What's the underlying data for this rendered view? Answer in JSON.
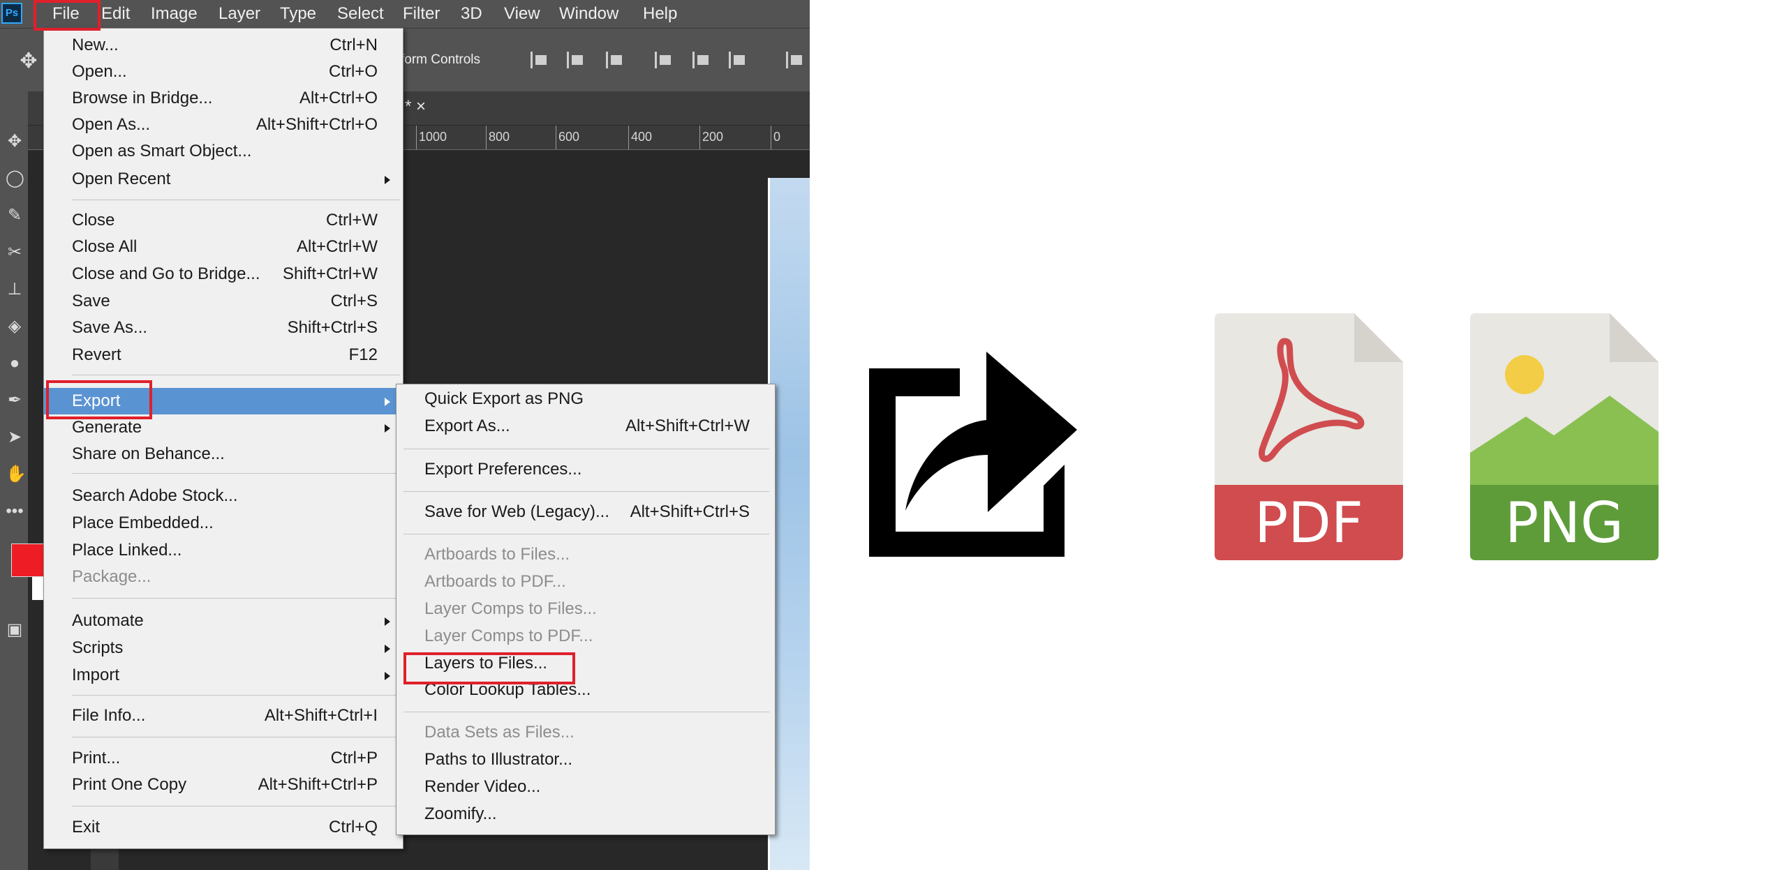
{
  "app": {
    "logo_text": "Ps"
  },
  "menubar": [
    {
      "label": "File"
    },
    {
      "label": "Edit"
    },
    {
      "label": "Image"
    },
    {
      "label": "Layer"
    },
    {
      "label": "Type"
    },
    {
      "label": "Select"
    },
    {
      "label": "Filter"
    },
    {
      "label": "3D"
    },
    {
      "label": "View"
    },
    {
      "label": "Window"
    },
    {
      "label": "Help"
    }
  ],
  "options_bar": {
    "transform_controls": "form Controls"
  },
  "document_tab": {
    "label": "* ×"
  },
  "ruler": {
    "labels": [
      "1000",
      "800",
      "600",
      "400",
      "200",
      "0"
    ]
  },
  "file_menu": {
    "items": [
      {
        "label": "New...",
        "shortcut": "Ctrl+N"
      },
      {
        "label": "Open...",
        "shortcut": "Ctrl+O"
      },
      {
        "label": "Browse in Bridge...",
        "shortcut": "Alt+Ctrl+O"
      },
      {
        "label": "Open As...",
        "shortcut": "Alt+Shift+Ctrl+O"
      },
      {
        "label": "Open as Smart Object...",
        "shortcut": ""
      },
      {
        "label": "Open Recent",
        "shortcut": "",
        "submenu": true
      },
      {
        "label": "Close",
        "shortcut": "Ctrl+W"
      },
      {
        "label": "Close All",
        "shortcut": "Alt+Ctrl+W"
      },
      {
        "label": "Close and Go to Bridge...",
        "shortcut": "Shift+Ctrl+W"
      },
      {
        "label": "Save",
        "shortcut": "Ctrl+S"
      },
      {
        "label": "Save As...",
        "shortcut": "Shift+Ctrl+S"
      },
      {
        "label": "Revert",
        "shortcut": "F12"
      },
      {
        "label": "Export",
        "shortcut": "",
        "submenu": true,
        "highlighted": true
      },
      {
        "label": "Generate",
        "shortcut": "",
        "submenu": true
      },
      {
        "label": "Share on Behance...",
        "shortcut": ""
      },
      {
        "label": "Search Adobe Stock...",
        "shortcut": ""
      },
      {
        "label": "Place Embedded...",
        "shortcut": ""
      },
      {
        "label": "Place Linked...",
        "shortcut": ""
      },
      {
        "label": "Package...",
        "shortcut": "",
        "disabled": true
      },
      {
        "label": "Automate",
        "shortcut": "",
        "submenu": true
      },
      {
        "label": "Scripts",
        "shortcut": "",
        "submenu": true
      },
      {
        "label": "Import",
        "shortcut": "",
        "submenu": true
      },
      {
        "label": "File Info...",
        "shortcut": "Alt+Shift+Ctrl+I"
      },
      {
        "label": "Print...",
        "shortcut": "Ctrl+P"
      },
      {
        "label": "Print One Copy",
        "shortcut": "Alt+Shift+Ctrl+P"
      },
      {
        "label": "Exit",
        "shortcut": "Ctrl+Q"
      }
    ]
  },
  "export_menu": {
    "items": [
      {
        "label": "Quick Export as PNG",
        "shortcut": ""
      },
      {
        "label": "Export As...",
        "shortcut": "Alt+Shift+Ctrl+W"
      },
      {
        "label": "Export Preferences...",
        "shortcut": ""
      },
      {
        "label": "Save for Web (Legacy)...",
        "shortcut": "Alt+Shift+Ctrl+S"
      },
      {
        "label": "Artboards to Files...",
        "shortcut": "",
        "disabled": true
      },
      {
        "label": "Artboards to PDF...",
        "shortcut": "",
        "disabled": true
      },
      {
        "label": "Layer Comps to Files...",
        "shortcut": "",
        "disabled": true
      },
      {
        "label": "Layer Comps to PDF...",
        "shortcut": "",
        "disabled": true
      },
      {
        "label": "Layers to Files...",
        "shortcut": ""
      },
      {
        "label": "Color Lookup Tables...",
        "shortcut": ""
      },
      {
        "label": "Data Sets as Files...",
        "shortcut": "",
        "disabled": true
      },
      {
        "label": "Paths to Illustrator...",
        "shortcut": ""
      },
      {
        "label": "Render Video...",
        "shortcut": ""
      },
      {
        "label": "Zoomify...",
        "shortcut": ""
      }
    ]
  },
  "illustration": {
    "export_icon": "share-export-icon",
    "pdf_icon": {
      "label": "PDF",
      "color": "#d04c4f"
    },
    "png_icon": {
      "label": "PNG",
      "color": "#5e9c3a"
    }
  },
  "colors": {
    "foreground": "#ee1c24",
    "menu_highlight": "#5a93d2",
    "annotation_red": "#e0202c"
  }
}
